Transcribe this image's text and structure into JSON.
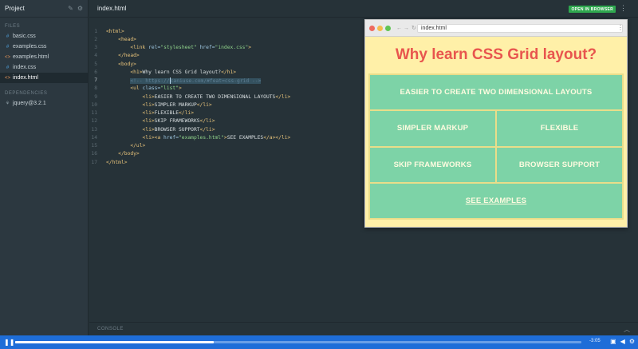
{
  "sidebar": {
    "title": "Project",
    "files_label": "FILES",
    "files": [
      {
        "name": "basic.css",
        "kind": "css"
      },
      {
        "name": "examples.css",
        "kind": "css"
      },
      {
        "name": "examples.html",
        "kind": "html"
      },
      {
        "name": "index.css",
        "kind": "css"
      },
      {
        "name": "index.html",
        "kind": "html",
        "active": true
      }
    ],
    "dependencies_label": "DEPENDENCIES",
    "dependencies": [
      {
        "name": "jquery@3.2.1"
      }
    ]
  },
  "editor": {
    "tab": "index.html",
    "open_button": "OPEN IN BROWSER",
    "current_line": 7,
    "lines": [
      "<html>",
      "    <head>",
      "        <link rel=\"stylesheet\" href=\"index.css\">",
      "    </head>",
      "    <body>",
      "        <h1>Why learn CSS Grid layout?</h1>",
      "        <!-- https://caniuse.com/#feat=css-grid -->",
      "        <ul class=\"list\">",
      "            <li>EASIER TO CREATE TWO DIMENSIONAL LAYOUTS</li>",
      "            <li>SIMPLER MARKUP</li>",
      "            <li>FLEXIBLE</li>",
      "            <li>SKIP FRAMEWORKS</li>",
      "            <li>BROWSER SUPPORT</li>",
      "            <li><a href=\"examples.html\">SEE EXAMPLES</a></li>",
      "        </ul>",
      "    </body>",
      "</html>"
    ]
  },
  "console": {
    "label": "CONSOLE"
  },
  "browser": {
    "url": "index.html",
    "heading": "Why learn CSS Grid layout?",
    "items": [
      "EASIER TO CREATE TWO DIMENSIONAL LAYOUTS",
      "SIMPLER MARKUP",
      "FLEXIBLE",
      "SKIP FRAMEWORKS",
      "BROWSER SUPPORT"
    ],
    "link": "SEE EXAMPLES"
  },
  "player": {
    "time": "-3:05",
    "progress": 0.35
  },
  "colors": {
    "accent_green": "#2fa84f",
    "player_blue": "#1e6dd8",
    "heading_red": "#e8554e",
    "grid_cell": "#7dd3a7",
    "page_bg": "#fff0a8"
  }
}
